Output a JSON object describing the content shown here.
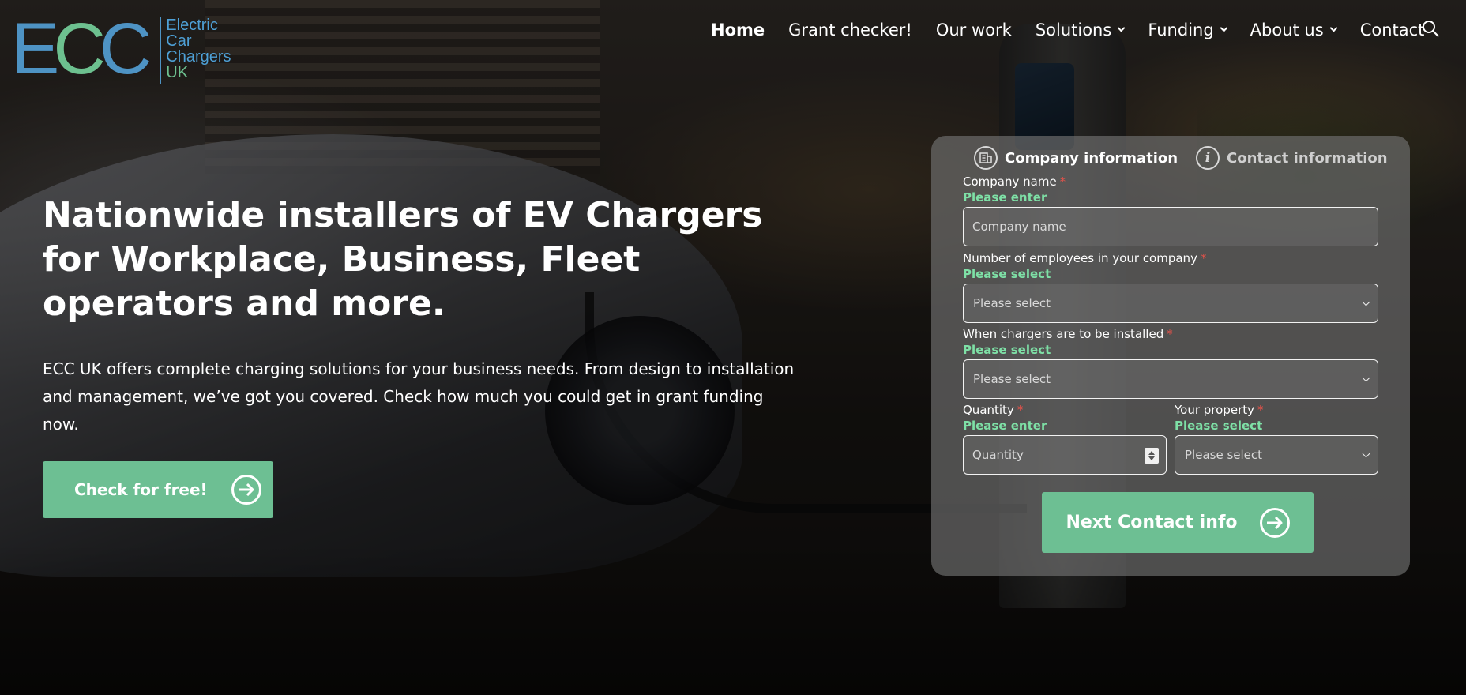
{
  "brand": {
    "logo_letters": [
      "E",
      "C",
      "C"
    ],
    "logo_words": [
      "Electric",
      "Car",
      "Chargers",
      "UK"
    ],
    "colors": {
      "blue": "#4e93c4",
      "green": "#6dc08f",
      "accent_button": "#6dbf93",
      "required": "#e2524a",
      "hint": "#7ee0a6"
    }
  },
  "nav": {
    "items": [
      {
        "label": "Home",
        "active": true
      },
      {
        "label": "Grant checker!"
      },
      {
        "label": "Our work"
      },
      {
        "label": "Solutions",
        "dropdown": true
      },
      {
        "label": "Funding",
        "dropdown": true
      },
      {
        "label": "About us",
        "dropdown": true
      },
      {
        "label": "Contact"
      }
    ],
    "search_icon": "search-icon"
  },
  "hero": {
    "title": "Nationwide installers of EV Chargers for Workplace, Business, Fleet operators and more.",
    "text": "ECC UK offers complete charging solutions for your business needs. From design to installation and management, we’ve got you covered. Check how much you could get in grant funding now.",
    "cta_label": "Check for free!"
  },
  "form": {
    "steps": [
      {
        "label": "Company information",
        "icon": "building-icon",
        "active": true
      },
      {
        "label": "Contact information",
        "icon": "info-icon",
        "icon_glyph": "i",
        "active": false
      }
    ],
    "required_mark": "*",
    "fields": {
      "company_name": {
        "label": "Company name",
        "hint": "Please enter",
        "placeholder": "Company name"
      },
      "employees": {
        "label": "Number of employees in your company",
        "hint": "Please select",
        "value": "Please select"
      },
      "install_time": {
        "label": "When chargers are to be installed",
        "hint": "Please select",
        "value": "Please select"
      },
      "quantity": {
        "label": "Quantity",
        "hint": "Please enter",
        "placeholder": "Quantity"
      },
      "property": {
        "label": "Your property",
        "hint": "Please select",
        "value": "Please select"
      }
    },
    "next_label": "Next Contact info"
  }
}
